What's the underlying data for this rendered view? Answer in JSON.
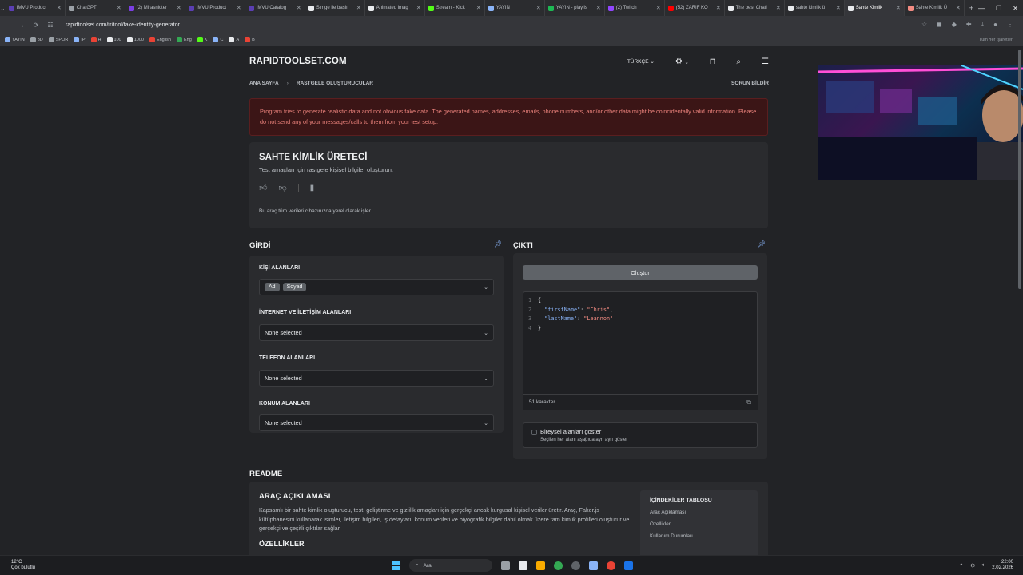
{
  "browser": {
    "tabs": [
      {
        "label": "IMVU Product",
        "color": "#5b3fb3"
      },
      {
        "label": "ChatGPT",
        "color": "#9aa0a6"
      },
      {
        "label": "(2) Mirasnicter",
        "color": "#7b3fe4"
      },
      {
        "label": "IMVU Product",
        "color": "#5b3fb3"
      },
      {
        "label": "IMVU Catalog",
        "color": "#5b3fb3"
      },
      {
        "label": "Simge ile başlı",
        "color": "#e8eaed"
      },
      {
        "label": "Animated imag",
        "color": "#e8eaed"
      },
      {
        "label": "Stream - Kick",
        "color": "#53fc18"
      },
      {
        "label": "YAYIN",
        "color": "#8ab4f8"
      },
      {
        "label": "YAYIN - playlis",
        "color": "#1db954"
      },
      {
        "label": "(2) Twitch",
        "color": "#9146ff"
      },
      {
        "label": "(52) ZARIF KO",
        "color": "#ff0000"
      },
      {
        "label": "The best Chati",
        "color": "#e8eaed"
      },
      {
        "label": "sahte kimlik ü",
        "color": "#e8eaed"
      },
      {
        "label": "Sahte Kimlik",
        "color": "#e8eaed"
      },
      {
        "label": "Sahte Kimlik Ü",
        "color": "#f28b82"
      }
    ],
    "url": "rapidtoolset.com/tr/tool/fake-identity-generator",
    "bookmarks": [
      {
        "label": "YAYIN",
        "color": "#8ab4f8"
      },
      {
        "label": "3D",
        "color": "#9aa0a6"
      },
      {
        "label": "SPOR",
        "color": "#9aa0a6"
      },
      {
        "label": "IP",
        "color": "#8ab4f8"
      },
      {
        "label": "H",
        "color": "#ea4335"
      },
      {
        "label": "100",
        "color": "#e8eaed"
      },
      {
        "label": "1000",
        "color": "#e8eaed"
      },
      {
        "label": "English",
        "color": "#ea4335"
      },
      {
        "label": "Eng",
        "color": "#34a853"
      },
      {
        "label": "K",
        "color": "#53fc18"
      },
      {
        "label": "C",
        "color": "#8ab4f8"
      },
      {
        "label": "A",
        "color": "#e8eaed"
      },
      {
        "label": "B",
        "color": "#ea4335"
      }
    ],
    "all_bookmarks": "Tüm Yer İşaretleri"
  },
  "site": {
    "logo": "RAPIDTOOLSET.COM",
    "language": "TÜRKÇE",
    "breadcrumb_home": "ANA SAYFA",
    "breadcrumb_current": "RASTGELE OLUŞTURUCULAR",
    "report": "SORUN BİLDİR",
    "warning": "Program tries to generate realistic data and not obvious fake data. The generated names, addresses, emails, phone numbers, and/or other data might be coincidentally valid information. Please do not send any of your messages/calls to them from your test setup.",
    "tool_title": "SAHTE KİMLİK ÜRETECİ",
    "tool_subtitle": "Test amaçları için rastgele kişisel bilgiler oluşturun.",
    "local_note": "Bu araç tüm verileri cihazınızda yerel olarak işler."
  },
  "input": {
    "title": "GİRDİ",
    "person_label": "KİŞİ ALANLARI",
    "person_chips": [
      "Ad",
      "Soyad"
    ],
    "internet_label": "İNTERNET VE İLETİŞİM ALANLARI",
    "internet_value": "None selected",
    "phone_label": "TELEFON ALANLARI",
    "phone_value": "None selected",
    "location_label": "KONUM ALANLARI",
    "location_value": "None selected"
  },
  "output": {
    "title": "ÇIKTI",
    "generate_button": "Oluştur",
    "code_lines": [
      "{",
      "\"firstName\": \"Chris\",",
      "\"lastName\": \"Leannon\"",
      "}"
    ],
    "first_key": "\"firstName\"",
    "first_val": "\"Chris\"",
    "last_key": "\"lastName\"",
    "last_val": "\"Leannon\"",
    "char_count": "51 karakter",
    "show_fields_label": "Bireysel alanları göster",
    "show_fields_desc": "Seçilen her alanı aşağıda ayrı ayrı göster"
  },
  "readme": {
    "title": "README",
    "section_title": "ARAÇ AÇIKLAMASI",
    "description": "Kapsamlı bir sahte kimlik oluşturucu, test, geliştirme ve gizlilik amaçları için gerçekçi ancak kurgusal kişisel veriler üretir. Araç, Faker.js kütüphanesini kullanarak isimler, iletişim bilgileri, iş detayları, konum verileri ve biyografik bilgiler dahil olmak üzere tam kimlik profilleri oluşturur ve gerçekçi ve çeşitli çıktılar sağlar.",
    "features_title": "ÖZELLİKLER",
    "toc_title": "İÇİNDEKİLER TABLOSU",
    "toc_items": [
      "Araç Açıklaması",
      "Özellikler",
      "Kullanım Durumları"
    ]
  },
  "taskbar": {
    "temp": "12°C",
    "weather": "Çok bulutlu",
    "search": "Ara",
    "time": "22:00",
    "date": "2.02.2026"
  }
}
